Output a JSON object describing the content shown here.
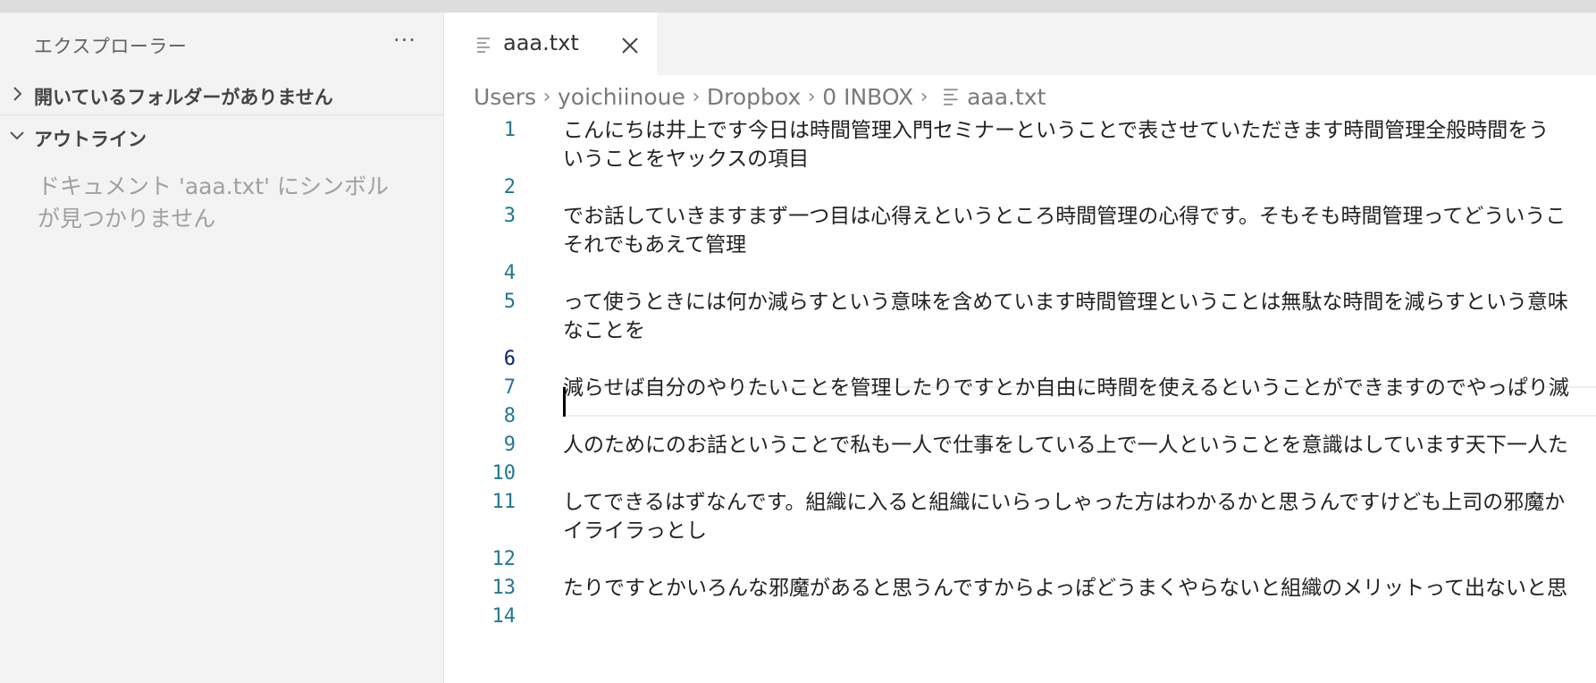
{
  "sidebar": {
    "title": "エクスプローラー",
    "more_label": "···",
    "sections": {
      "folders_label": "開いているフォルダーがありません",
      "outline_label": "アウトライン"
    },
    "outline_message": "ドキュメント 'aaa.txt' にシンボルが見つかりません"
  },
  "editor": {
    "tab": {
      "label": "aaa.txt",
      "icon": "text-file-icon",
      "close_icon": "close-icon"
    },
    "breadcrumb": [
      "Users",
      "yoichiinoue",
      "Dropbox",
      "0 INBOX",
      "aaa.txt"
    ],
    "active_line": 6,
    "lines": [
      {
        "number": "1",
        "text": [
          "こんにちは井上です今日は時間管理入門セミナーということで表させていただきます時間管理全般時間をう",
          "いうことをヤックスの項目"
        ]
      },
      {
        "number": "2",
        "text": [
          ""
        ]
      },
      {
        "number": "3",
        "text": [
          "でお話していきますまず一つ目は心得えというところ時間管理の心得です。そもそも時間管理ってどういうこ",
          "それでもあえて管理"
        ]
      },
      {
        "number": "4",
        "text": [
          ""
        ]
      },
      {
        "number": "5",
        "text": [
          "って使うときには何か減らすという意味を含めています時間管理ということは無駄な時間を減らすという意味",
          "なことを"
        ]
      },
      {
        "number": "6",
        "text": [
          ""
        ]
      },
      {
        "number": "7",
        "text": [
          "減らせば自分のやりたいことを管理したりですとか自由に時間を使えるということができますのでやっぱり滅"
        ]
      },
      {
        "number": "8",
        "text": [
          ""
        ]
      },
      {
        "number": "9",
        "text": [
          "人のためにのお話ということで私も一人で仕事をしている上で一人ということを意識はしています天下一人た"
        ]
      },
      {
        "number": "10",
        "text": [
          ""
        ]
      },
      {
        "number": "11",
        "text": [
          "してできるはずなんです。組織に入ると組織にいらっしゃった方はわかるかと思うんですけども上司の邪魔か",
          "イライラっとし"
        ]
      },
      {
        "number": "12",
        "text": [
          ""
        ]
      },
      {
        "number": "13",
        "text": [
          "たりですとかいろんな邪魔があると思うんですからよっぽどうまくやらないと組織のメリットって出ないと思"
        ]
      },
      {
        "number": "14",
        "text": [
          ""
        ]
      }
    ]
  }
}
